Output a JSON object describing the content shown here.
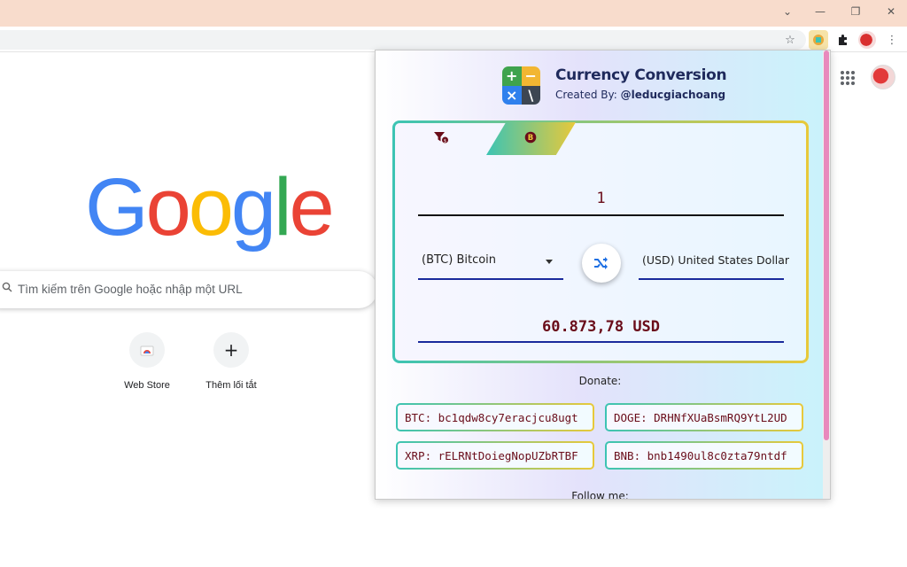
{
  "window": {
    "minimize_glyph": "—",
    "chevron_glyph": "⌄",
    "restore_glyph": "❐",
    "close_glyph": "✕"
  },
  "toolbar": {
    "star_glyph": "☆",
    "puzzle_glyph": "✦",
    "menu_glyph": "⋮"
  },
  "ntp": {
    "search_placeholder": "Tìm kiếm trên Google hoặc nhập một URL",
    "logo_letters": [
      "G",
      "o",
      "o",
      "g",
      "l",
      "e"
    ],
    "shortcuts": [
      {
        "label": "Web Store",
        "icon": "webstore-icon"
      },
      {
        "label": "Thêm lối tắt",
        "icon": "plus-icon",
        "glyph": "+"
      }
    ]
  },
  "extension": {
    "title": "Currency Conversion",
    "created_by_label": "Created By:",
    "author": "@leducgiachoang",
    "logo_cells": [
      "+",
      "−",
      "×",
      "\\"
    ],
    "tabs": [
      {
        "icon": "filter-currency-icon",
        "glyph": "⧩"
      },
      {
        "icon": "bitcoin-icon",
        "glyph": "฿"
      }
    ],
    "amount": "1",
    "from_currency": "(BTC) Bitcoin",
    "to_currency": "(USD) United States Dollar",
    "swap_glyph": "⇄",
    "result": "60.873,78 USD",
    "donate_label": "Donate:",
    "addresses": [
      "BTC: bc1qdw8cy7eracjcu8ugt",
      "DOGE: DRHNfXUaBsmRQ9YtL2UD",
      "XRP: rELRNtDoiegNopUZbRTBF",
      "BNB: bnb1490ul8c0zta79ntdf"
    ],
    "follow_label": "Follow me:"
  },
  "colors": {
    "titlebar": "#f8dccc",
    "google_blue": "#4285f4",
    "google_red": "#ea4335",
    "google_yellow": "#fbbc05",
    "google_green": "#34a853",
    "accent_dark_red": "#6a0d1a",
    "accent_navy": "#1a2a9c"
  }
}
